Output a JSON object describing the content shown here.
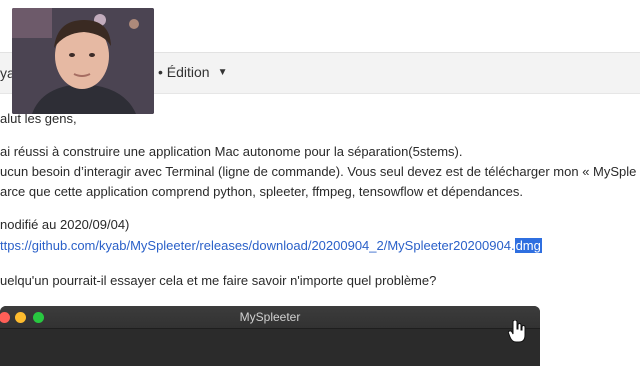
{
  "toolbar": {
    "left_text": "yal",
    "edit_label": "• Édition"
  },
  "post": {
    "greeting": "alut les gens,",
    "line1": "ai réussi à construire une application Mac autonome pour la séparation(5stems).",
    "line2": "ucun besoin d’interagir avec Terminal (ligne de commande). Vous seul devez est de télécharger mon « MySple",
    "line3": "arce que cette application comprend python, spleeter, ffmpeg, tensowflow et dépendances.",
    "modified": "nodifié au 2020/09/04)",
    "link_main": "ttps://github.com/kyab/MySpleeter/releases/download/20200904_2/MySpleeter20200904.",
    "link_selected": "dmg",
    "question": "uelqu'un pourrait-il essayer cela et me faire savoir n'importe quel problème?"
  },
  "window": {
    "title": "MySpleeter"
  },
  "icons": {
    "caret": "caret-down-icon",
    "cursor": "hand-pointer-icon"
  },
  "colors": {
    "link": "#2b61c9",
    "selection": "#2f6fe0",
    "window_bg": "#2b2b2b"
  }
}
